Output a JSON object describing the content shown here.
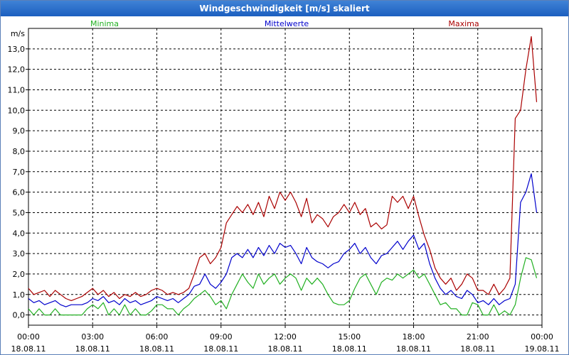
{
  "window": {
    "title": "Windgeschwindigkeit [m/s] skaliert"
  },
  "chart_data": {
    "type": "line",
    "title": "Windgeschwindigkeit [m/s] skaliert",
    "ylabel": "m/s",
    "ylim": [
      -0.5,
      14.0
    ],
    "xlim": [
      0,
      24
    ],
    "grid": true,
    "y_ticks": [
      {
        "v": 0,
        "label": "0,0"
      },
      {
        "v": 1,
        "label": "1,0"
      },
      {
        "v": 2,
        "label": "2,0"
      },
      {
        "v": 3,
        "label": "3,0"
      },
      {
        "v": 4,
        "label": "4,0"
      },
      {
        "v": 5,
        "label": "5,0"
      },
      {
        "v": 6,
        "label": "6,0"
      },
      {
        "v": 7,
        "label": "7,0"
      },
      {
        "v": 8,
        "label": "8,0"
      },
      {
        "v": 9,
        "label": "9,0"
      },
      {
        "v": 10,
        "label": "10,0"
      },
      {
        "v": 11,
        "label": "11,0"
      },
      {
        "v": 12,
        "label": "12,0"
      },
      {
        "v": 13,
        "label": "13,0"
      }
    ],
    "x_ticks": [
      {
        "v": 0,
        "time": "00:00",
        "date": "18.08.11"
      },
      {
        "v": 3,
        "time": "03:00",
        "date": "18.08.11"
      },
      {
        "v": 6,
        "time": "06:00",
        "date": "18.08.11"
      },
      {
        "v": 9,
        "time": "09:00",
        "date": "18.08.11"
      },
      {
        "v": 12,
        "time": "12:00",
        "date": "18.08.11"
      },
      {
        "v": 15,
        "time": "15:00",
        "date": "18.08.11"
      },
      {
        "v": 18,
        "time": "18:00",
        "date": "18.08.11"
      },
      {
        "v": 21,
        "time": "21:00",
        "date": "18.08.11"
      },
      {
        "v": 24,
        "time": "00:00",
        "date": "19.08.11"
      }
    ],
    "legend": [
      {
        "name": "Minima",
        "color": "#22b022",
        "position": "top-left"
      },
      {
        "name": "Mittelwerte",
        "color": "#0000cc",
        "position": "top-center"
      },
      {
        "name": "Maxima",
        "color": "#aa0000",
        "position": "top-right"
      }
    ],
    "series": [
      {
        "name": "Minima",
        "color": "#22b022",
        "points": [
          [
            0,
            0.3
          ],
          [
            0.25,
            0.0
          ],
          [
            0.5,
            0.3
          ],
          [
            0.75,
            0.0
          ],
          [
            1,
            0.0
          ],
          [
            1.25,
            0.3
          ],
          [
            1.5,
            0.0
          ],
          [
            1.75,
            0.0
          ],
          [
            2,
            0.0
          ],
          [
            2.25,
            0.0
          ],
          [
            2.5,
            0.0
          ],
          [
            2.75,
            0.3
          ],
          [
            3,
            0.5
          ],
          [
            3.25,
            0.3
          ],
          [
            3.5,
            0.6
          ],
          [
            3.75,
            0.0
          ],
          [
            4,
            0.3
          ],
          [
            4.25,
            0.0
          ],
          [
            4.5,
            0.5
          ],
          [
            4.75,
            0.0
          ],
          [
            5,
            0.3
          ],
          [
            5.25,
            0.0
          ],
          [
            5.5,
            0.0
          ],
          [
            5.75,
            0.2
          ],
          [
            6,
            0.5
          ],
          [
            6.25,
            0.5
          ],
          [
            6.5,
            0.3
          ],
          [
            6.75,
            0.3
          ],
          [
            7,
            0.0
          ],
          [
            7.25,
            0.3
          ],
          [
            7.5,
            0.5
          ],
          [
            7.75,
            0.8
          ],
          [
            8,
            1.0
          ],
          [
            8.25,
            1.2
          ],
          [
            8.5,
            0.9
          ],
          [
            8.75,
            0.5
          ],
          [
            9,
            0.7
          ],
          [
            9.25,
            0.3
          ],
          [
            9.5,
            1.0
          ],
          [
            9.75,
            1.5
          ],
          [
            10,
            2.0
          ],
          [
            10.25,
            1.6
          ],
          [
            10.5,
            1.3
          ],
          [
            10.75,
            2.0
          ],
          [
            11,
            1.5
          ],
          [
            11.25,
            1.8
          ],
          [
            11.5,
            2.0
          ],
          [
            11.75,
            1.5
          ],
          [
            12,
            1.8
          ],
          [
            12.25,
            2.0
          ],
          [
            12.5,
            1.8
          ],
          [
            12.75,
            1.2
          ],
          [
            13,
            1.8
          ],
          [
            13.25,
            1.5
          ],
          [
            13.5,
            1.8
          ],
          [
            13.75,
            1.5
          ],
          [
            14,
            1.0
          ],
          [
            14.25,
            0.6
          ],
          [
            14.5,
            0.5
          ],
          [
            14.75,
            0.5
          ],
          [
            15,
            0.7
          ],
          [
            15.25,
            1.3
          ],
          [
            15.5,
            1.8
          ],
          [
            15.75,
            2.0
          ],
          [
            16,
            1.5
          ],
          [
            16.25,
            1.0
          ],
          [
            16.5,
            1.6
          ],
          [
            16.75,
            1.8
          ],
          [
            17,
            1.7
          ],
          [
            17.25,
            2.0
          ],
          [
            17.5,
            1.8
          ],
          [
            17.75,
            2.0
          ],
          [
            18,
            2.2
          ],
          [
            18.25,
            1.8
          ],
          [
            18.5,
            2.0
          ],
          [
            18.75,
            1.5
          ],
          [
            19,
            1.0
          ],
          [
            19.25,
            0.5
          ],
          [
            19.5,
            0.6
          ],
          [
            19.75,
            0.3
          ],
          [
            20,
            0.3
          ],
          [
            20.25,
            0.0
          ],
          [
            20.5,
            0.0
          ],
          [
            20.75,
            0.6
          ],
          [
            21,
            0.5
          ],
          [
            21.25,
            0.0
          ],
          [
            21.5,
            0.0
          ],
          [
            21.75,
            0.5
          ],
          [
            22,
            0.0
          ],
          [
            22.25,
            0.2
          ],
          [
            22.5,
            0.0
          ],
          [
            22.75,
            0.5
          ],
          [
            23,
            1.8
          ],
          [
            23.25,
            2.8
          ],
          [
            23.5,
            2.7
          ],
          [
            23.75,
            1.8
          ]
        ]
      },
      {
        "name": "Mittelwerte",
        "color": "#0000cc",
        "points": [
          [
            0,
            0.8
          ],
          [
            0.25,
            0.6
          ],
          [
            0.5,
            0.7
          ],
          [
            0.75,
            0.5
          ],
          [
            1,
            0.6
          ],
          [
            1.25,
            0.7
          ],
          [
            1.5,
            0.5
          ],
          [
            1.75,
            0.4
          ],
          [
            2,
            0.5
          ],
          [
            2.25,
            0.5
          ],
          [
            2.5,
            0.5
          ],
          [
            2.75,
            0.6
          ],
          [
            3,
            0.8
          ],
          [
            3.25,
            0.7
          ],
          [
            3.5,
            0.9
          ],
          [
            3.75,
            0.6
          ],
          [
            4,
            0.7
          ],
          [
            4.25,
            0.5
          ],
          [
            4.5,
            0.8
          ],
          [
            4.75,
            0.6
          ],
          [
            5,
            0.7
          ],
          [
            5.25,
            0.5
          ],
          [
            5.5,
            0.6
          ],
          [
            5.75,
            0.7
          ],
          [
            6,
            0.9
          ],
          [
            6.25,
            0.8
          ],
          [
            6.5,
            0.7
          ],
          [
            6.75,
            0.8
          ],
          [
            7,
            0.6
          ],
          [
            7.25,
            0.8
          ],
          [
            7.5,
            1.0
          ],
          [
            7.75,
            1.4
          ],
          [
            8,
            1.5
          ],
          [
            8.25,
            2.0
          ],
          [
            8.5,
            1.5
          ],
          [
            8.75,
            1.3
          ],
          [
            9,
            1.6
          ],
          [
            9.25,
            2.0
          ],
          [
            9.5,
            2.8
          ],
          [
            9.75,
            3.0
          ],
          [
            10,
            2.8
          ],
          [
            10.25,
            3.2
          ],
          [
            10.5,
            2.8
          ],
          [
            10.75,
            3.3
          ],
          [
            11,
            2.9
          ],
          [
            11.25,
            3.4
          ],
          [
            11.5,
            3.0
          ],
          [
            11.75,
            3.5
          ],
          [
            12,
            3.3
          ],
          [
            12.25,
            3.4
          ],
          [
            12.5,
            3.0
          ],
          [
            12.75,
            2.5
          ],
          [
            13,
            3.3
          ],
          [
            13.25,
            2.8
          ],
          [
            13.5,
            2.6
          ],
          [
            13.75,
            2.5
          ],
          [
            14,
            2.3
          ],
          [
            14.25,
            2.5
          ],
          [
            14.5,
            2.6
          ],
          [
            14.75,
            3.0
          ],
          [
            15,
            3.2
          ],
          [
            15.25,
            3.5
          ],
          [
            15.5,
            3.0
          ],
          [
            15.75,
            3.3
          ],
          [
            16,
            2.8
          ],
          [
            16.25,
            2.5
          ],
          [
            16.5,
            2.9
          ],
          [
            16.75,
            3.0
          ],
          [
            17,
            3.3
          ],
          [
            17.25,
            3.6
          ],
          [
            17.5,
            3.2
          ],
          [
            17.75,
            3.6
          ],
          [
            18,
            3.9
          ],
          [
            18.25,
            3.2
          ],
          [
            18.5,
            3.5
          ],
          [
            18.75,
            2.5
          ],
          [
            19,
            1.8
          ],
          [
            19.25,
            1.3
          ],
          [
            19.5,
            1.0
          ],
          [
            19.75,
            1.2
          ],
          [
            20,
            0.9
          ],
          [
            20.25,
            0.8
          ],
          [
            20.5,
            1.2
          ],
          [
            20.75,
            1.0
          ],
          [
            21,
            0.6
          ],
          [
            21.25,
            0.7
          ],
          [
            21.5,
            0.5
          ],
          [
            21.75,
            0.8
          ],
          [
            22,
            0.5
          ],
          [
            22.25,
            0.7
          ],
          [
            22.5,
            0.8
          ],
          [
            22.75,
            1.5
          ],
          [
            23,
            5.5
          ],
          [
            23.25,
            6.0
          ],
          [
            23.5,
            6.9
          ],
          [
            23.75,
            5.0
          ]
        ]
      },
      {
        "name": "Maxima",
        "color": "#aa0000",
        "points": [
          [
            0,
            1.3
          ],
          [
            0.25,
            1.0
          ],
          [
            0.5,
            1.1
          ],
          [
            0.75,
            1.2
          ],
          [
            1,
            0.9
          ],
          [
            1.25,
            1.2
          ],
          [
            1.5,
            1.0
          ],
          [
            1.75,
            0.8
          ],
          [
            2,
            0.7
          ],
          [
            2.25,
            0.8
          ],
          [
            2.5,
            0.9
          ],
          [
            2.75,
            1.1
          ],
          [
            3,
            1.3
          ],
          [
            3.25,
            1.0
          ],
          [
            3.5,
            1.2
          ],
          [
            3.75,
            0.9
          ],
          [
            4,
            1.1
          ],
          [
            4.25,
            0.8
          ],
          [
            4.5,
            1.0
          ],
          [
            4.75,
            0.9
          ],
          [
            5,
            1.1
          ],
          [
            5.25,
            0.9
          ],
          [
            5.5,
            1.0
          ],
          [
            5.75,
            1.2
          ],
          [
            6,
            1.3
          ],
          [
            6.25,
            1.2
          ],
          [
            6.5,
            1.0
          ],
          [
            6.75,
            1.1
          ],
          [
            7,
            1.0
          ],
          [
            7.25,
            1.1
          ],
          [
            7.5,
            1.3
          ],
          [
            7.75,
            2.0
          ],
          [
            8,
            2.8
          ],
          [
            8.25,
            3.0
          ],
          [
            8.5,
            2.5
          ],
          [
            8.75,
            2.8
          ],
          [
            9,
            3.3
          ],
          [
            9.25,
            4.5
          ],
          [
            9.5,
            4.9
          ],
          [
            9.75,
            5.3
          ],
          [
            10,
            5.0
          ],
          [
            10.25,
            5.4
          ],
          [
            10.5,
            4.9
          ],
          [
            10.75,
            5.5
          ],
          [
            11,
            4.8
          ],
          [
            11.25,
            5.8
          ],
          [
            11.5,
            5.2
          ],
          [
            11.75,
            6.0
          ],
          [
            12,
            5.6
          ],
          [
            12.25,
            6.0
          ],
          [
            12.5,
            5.5
          ],
          [
            12.75,
            4.8
          ],
          [
            13,
            5.7
          ],
          [
            13.25,
            4.5
          ],
          [
            13.5,
            4.9
          ],
          [
            13.75,
            4.7
          ],
          [
            14,
            4.3
          ],
          [
            14.25,
            4.8
          ],
          [
            14.5,
            5.0
          ],
          [
            14.75,
            5.4
          ],
          [
            15,
            5.0
          ],
          [
            15.25,
            5.5
          ],
          [
            15.5,
            4.9
          ],
          [
            15.75,
            5.2
          ],
          [
            16,
            4.3
          ],
          [
            16.25,
            4.5
          ],
          [
            16.5,
            4.2
          ],
          [
            16.75,
            4.4
          ],
          [
            17,
            5.8
          ],
          [
            17.25,
            5.5
          ],
          [
            17.5,
            5.8
          ],
          [
            17.75,
            5.2
          ],
          [
            18,
            5.8
          ],
          [
            18.25,
            4.8
          ],
          [
            18.5,
            3.9
          ],
          [
            18.75,
            3.2
          ],
          [
            19,
            2.3
          ],
          [
            19.25,
            1.8
          ],
          [
            19.5,
            1.5
          ],
          [
            19.75,
            1.8
          ],
          [
            20,
            1.2
          ],
          [
            20.25,
            1.5
          ],
          [
            20.5,
            2.0
          ],
          [
            20.75,
            1.8
          ],
          [
            21,
            1.2
          ],
          [
            21.25,
            1.2
          ],
          [
            21.5,
            1.0
          ],
          [
            21.75,
            1.5
          ],
          [
            22,
            1.0
          ],
          [
            22.25,
            1.3
          ],
          [
            22.5,
            1.8
          ],
          [
            22.75,
            9.6
          ],
          [
            23,
            10.0
          ],
          [
            23.25,
            12.0
          ],
          [
            23.5,
            13.6
          ],
          [
            23.75,
            10.4
          ]
        ]
      }
    ]
  }
}
